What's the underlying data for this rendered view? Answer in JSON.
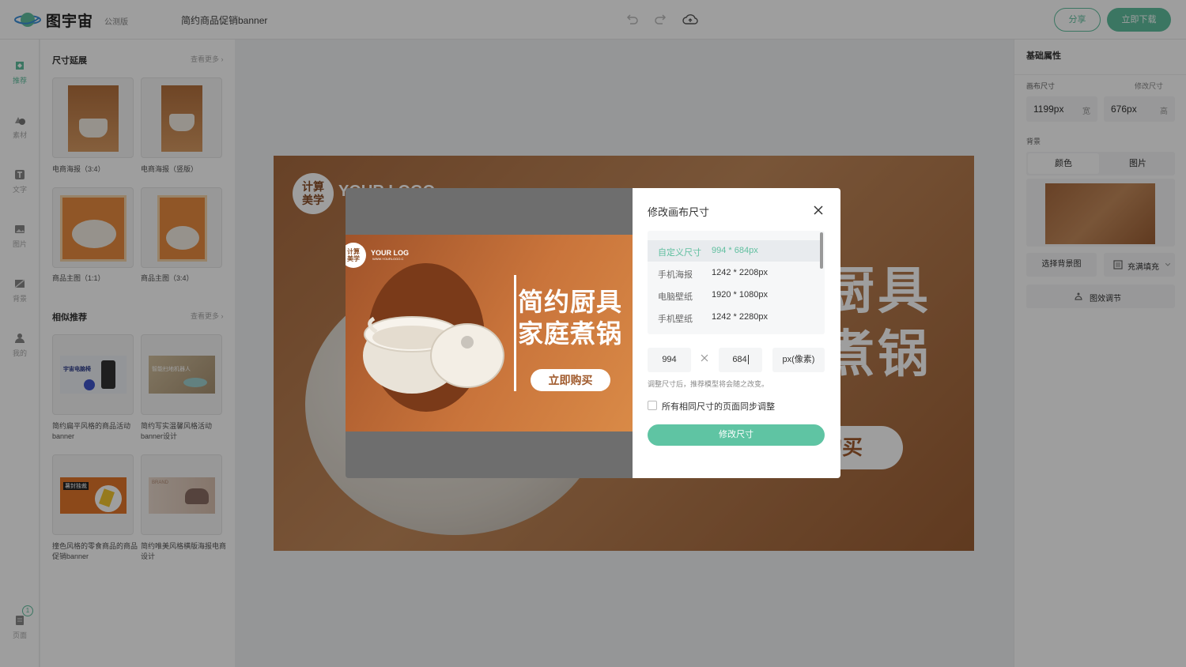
{
  "app": {
    "name": "图宇宙",
    "beta": "公测版",
    "doc_title": "简约商品促销banner"
  },
  "toolbar": {
    "share_label": "分享",
    "download_label": "立即下载",
    "undo_icon": "undo-icon",
    "redo_icon": "redo-icon",
    "cloud_icon": "cloud-save-icon"
  },
  "rail": {
    "items": [
      {
        "label": "推荐",
        "icon": "recommend-icon"
      },
      {
        "label": "素材",
        "icon": "shapes-icon"
      },
      {
        "label": "文字",
        "icon": "text-icon"
      },
      {
        "label": "图片",
        "icon": "image-icon"
      },
      {
        "label": "背景",
        "icon": "background-icon"
      },
      {
        "label": "我的",
        "icon": "user-icon"
      }
    ],
    "pages_label": "页面",
    "pages_count": "1"
  },
  "panel": {
    "size_section": {
      "title": "尺寸延展",
      "more": "查看更多"
    },
    "size_cards": [
      {
        "label": "电商海报（3:4）"
      },
      {
        "label": "电商海报（竖版）"
      },
      {
        "label": "商品主图（1:1）"
      },
      {
        "label": "商品主图（3:4）"
      }
    ],
    "similar_section": {
      "title": "相似推荐",
      "more": "查看更多"
    },
    "similar_cards": [
      {
        "label": "简约扁平风格的商品活动banner",
        "thumb_text": "宇宙电脑椅"
      },
      {
        "label": "简约写实温馨风格活动banner设计",
        "thumb_text": "智能扫地机器人"
      },
      {
        "label": "撞色风格的零食商品的商品促销banner",
        "thumb_text": "薯封独裁"
      },
      {
        "label": "简约唯美风格横版海报电商设计",
        "thumb_text": "BRAND"
      }
    ]
  },
  "canvas": {
    "logo_line1": "计算",
    "logo_line2": "美学",
    "logo_text": "YOUR LOGO",
    "headline1": "简约厨具",
    "headline2": "家庭煮锅",
    "cta": "立即购买"
  },
  "right_panel": {
    "title": "基础属性",
    "canvas_size_label": "画布尺寸",
    "modify_size_label": "修改尺寸",
    "width_value": "1199px",
    "width_unit": "宽",
    "height_value": "676px",
    "height_unit": "高",
    "background_label": "背景",
    "bg_tabs": [
      "颜色",
      "图片"
    ],
    "choose_bg_label": "选择背景图",
    "fill_mode_label": "充满填充",
    "effect_label": "图效调节"
  },
  "modal": {
    "title": "修改画布尺寸",
    "sizes": [
      {
        "name": "自定义尺寸",
        "dims": "994 * 684px",
        "selected": true
      },
      {
        "name": "手机海报",
        "dims": "1242 * 2208px",
        "selected": false
      },
      {
        "name": "电脑壁纸",
        "dims": "1920 * 1080px",
        "selected": false
      },
      {
        "name": "手机壁纸",
        "dims": "1242 * 2280px",
        "selected": false
      }
    ],
    "width_input": "994",
    "height_input": "684",
    "unit_label": "px(像素)",
    "hint": "调整尺寸后，推荐模型将会随之改变。",
    "sync_label": "所有相同尺寸的页面同步调整",
    "apply_label": "修改尺寸",
    "preview": {
      "logo_line1": "计算",
      "logo_line2": "美学",
      "logo_text": "YOUR LOG",
      "logo_sub": "WWW.YOURLOGO.C",
      "headline1": "简约厨具",
      "headline2": "家庭煮锅",
      "cta": "立即购买"
    }
  },
  "colors": {
    "accent": "#5fbf9f",
    "canvas_brown": "#a86a3f"
  }
}
